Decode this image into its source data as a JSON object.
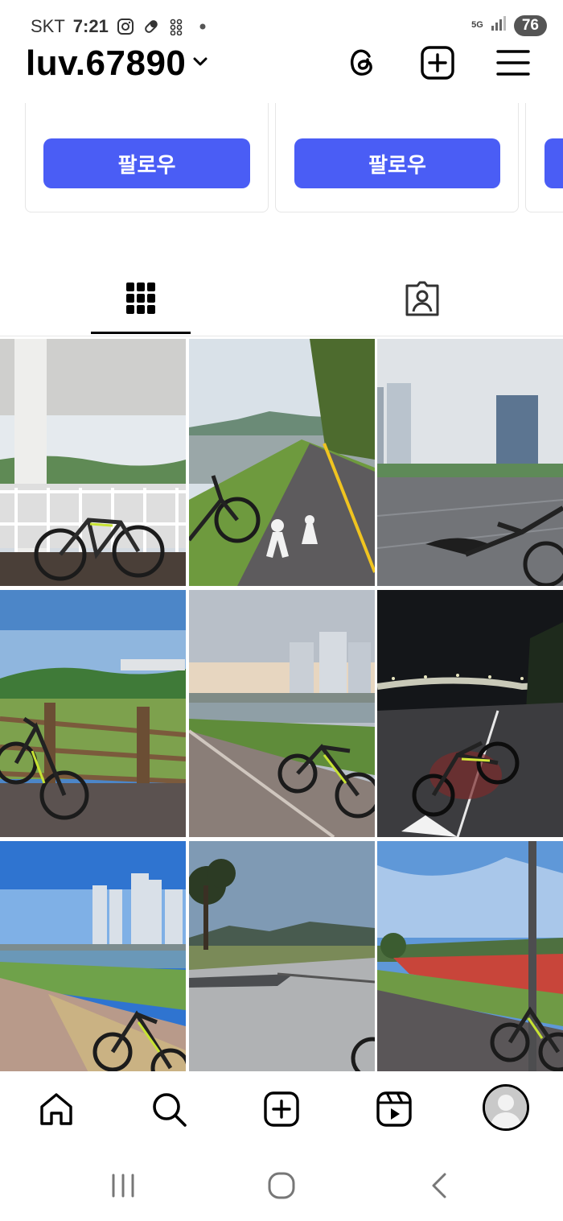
{
  "status_bar": {
    "carrier": "SKT",
    "time": "7:21",
    "network": "5G",
    "battery": "76",
    "icons": [
      "instagram-icon",
      "pill-icon",
      "dots-app-icon",
      "notification-dot-icon",
      "signal-icon"
    ]
  },
  "header": {
    "username": "luv.67890",
    "icons": [
      "chevron-down-icon",
      "threads-icon",
      "create-post-icon",
      "menu-icon"
    ]
  },
  "suggestions": {
    "follow_label": "팔로우",
    "card_count_visible": 3
  },
  "tabs": [
    {
      "name": "posts",
      "icon": "grid-icon",
      "selected": true
    },
    {
      "name": "tagged",
      "icon": "tagged-person-icon",
      "selected": false
    }
  ],
  "grid": {
    "posts": [
      {
        "scene": "covered pavilion by river with bicycle"
      },
      {
        "scene": "riverside bike path with pedestrian marking"
      },
      {
        "scene": "plaza with high-rise towers and bicycle"
      },
      {
        "scene": "wooden fence, green hills, bicycle"
      },
      {
        "scene": "river path, apartment towers, bicycle"
      },
      {
        "scene": "night bridge with lit bicycle"
      },
      {
        "scene": "towers by river, grass path, bicycle"
      },
      {
        "scene": "paved park path with tree"
      },
      {
        "scene": "flower field path with lamp post and bicycle"
      }
    ]
  },
  "bottom_nav": {
    "items": [
      "home-icon",
      "search-icon",
      "create-icon",
      "reels-icon",
      "profile-avatar"
    ]
  },
  "system_nav": {
    "items": [
      "recent-apps-icon",
      "home-circle-icon",
      "back-icon"
    ]
  },
  "colors": {
    "follow_button": "#4a5df5",
    "text": "#000000",
    "divider": "#e6e6e6"
  }
}
